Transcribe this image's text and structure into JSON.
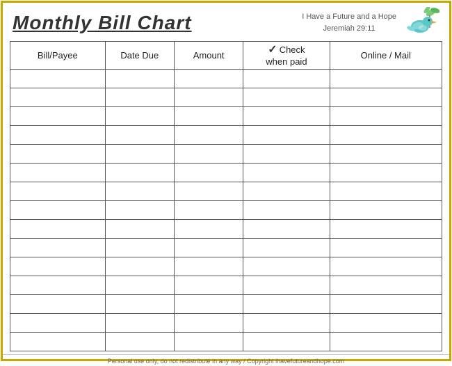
{
  "header": {
    "title": "Monthly Bill Chart",
    "tagline_line1": "I Have a Future and a Hope",
    "tagline_line2": "Jeremiah 29:11"
  },
  "columns": [
    {
      "key": "bill_payee",
      "label": "Bill/Payee"
    },
    {
      "key": "date_due",
      "label": "Date Due"
    },
    {
      "key": "amount",
      "label": "Amount"
    },
    {
      "key": "check_paid",
      "label_check": "✓",
      "label_when": "Check",
      "label_sub": "when paid"
    },
    {
      "key": "online_mail",
      "label": "Online / Mail"
    }
  ],
  "row_count": 15,
  "footer": {
    "text": "Personal use only, do not redistribute in any way / Copyright ihavefutureandhope.com"
  }
}
